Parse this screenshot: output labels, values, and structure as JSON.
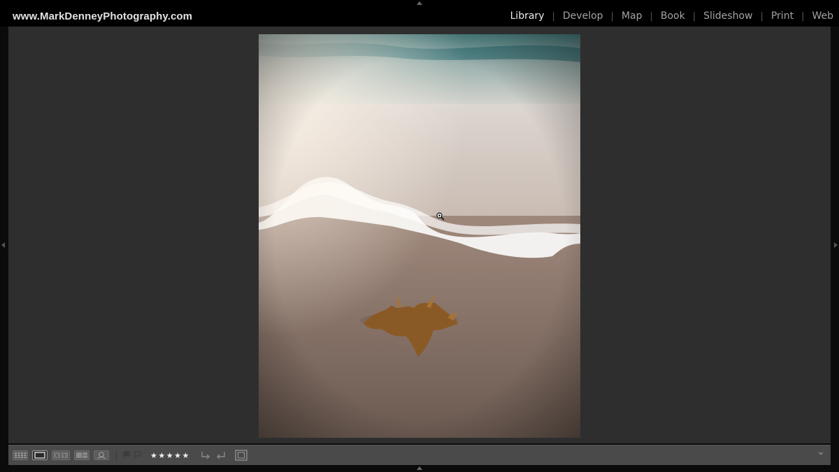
{
  "identity_plate": {
    "text": "www.MarkDenneyPhotography.com"
  },
  "modules": [
    {
      "label": "Library",
      "active": true
    },
    {
      "label": "Develop",
      "active": false
    },
    {
      "label": "Map",
      "active": false
    },
    {
      "label": "Book",
      "active": false
    },
    {
      "label": "Slideshow",
      "active": false
    },
    {
      "label": "Print",
      "active": false
    },
    {
      "label": "Web",
      "active": false
    }
  ],
  "module_separator": "|",
  "toolbar": {
    "view_modes": [
      {
        "icon": "grid-view-icon",
        "active": false
      },
      {
        "icon": "loupe-view-icon",
        "active": true
      },
      {
        "icon": "compare-view-icon",
        "active": false
      },
      {
        "icon": "survey-view-icon",
        "active": false
      },
      {
        "icon": "people-view-icon",
        "active": false
      }
    ],
    "rating": {
      "stars": 5,
      "max": 5,
      "glyphs": "★★★★★"
    }
  },
  "colors": {
    "background": "#2e2e2e",
    "toolbar": "#4a4a4a",
    "active_module": "#ececec",
    "inactive_module": "#a3a3a3"
  }
}
